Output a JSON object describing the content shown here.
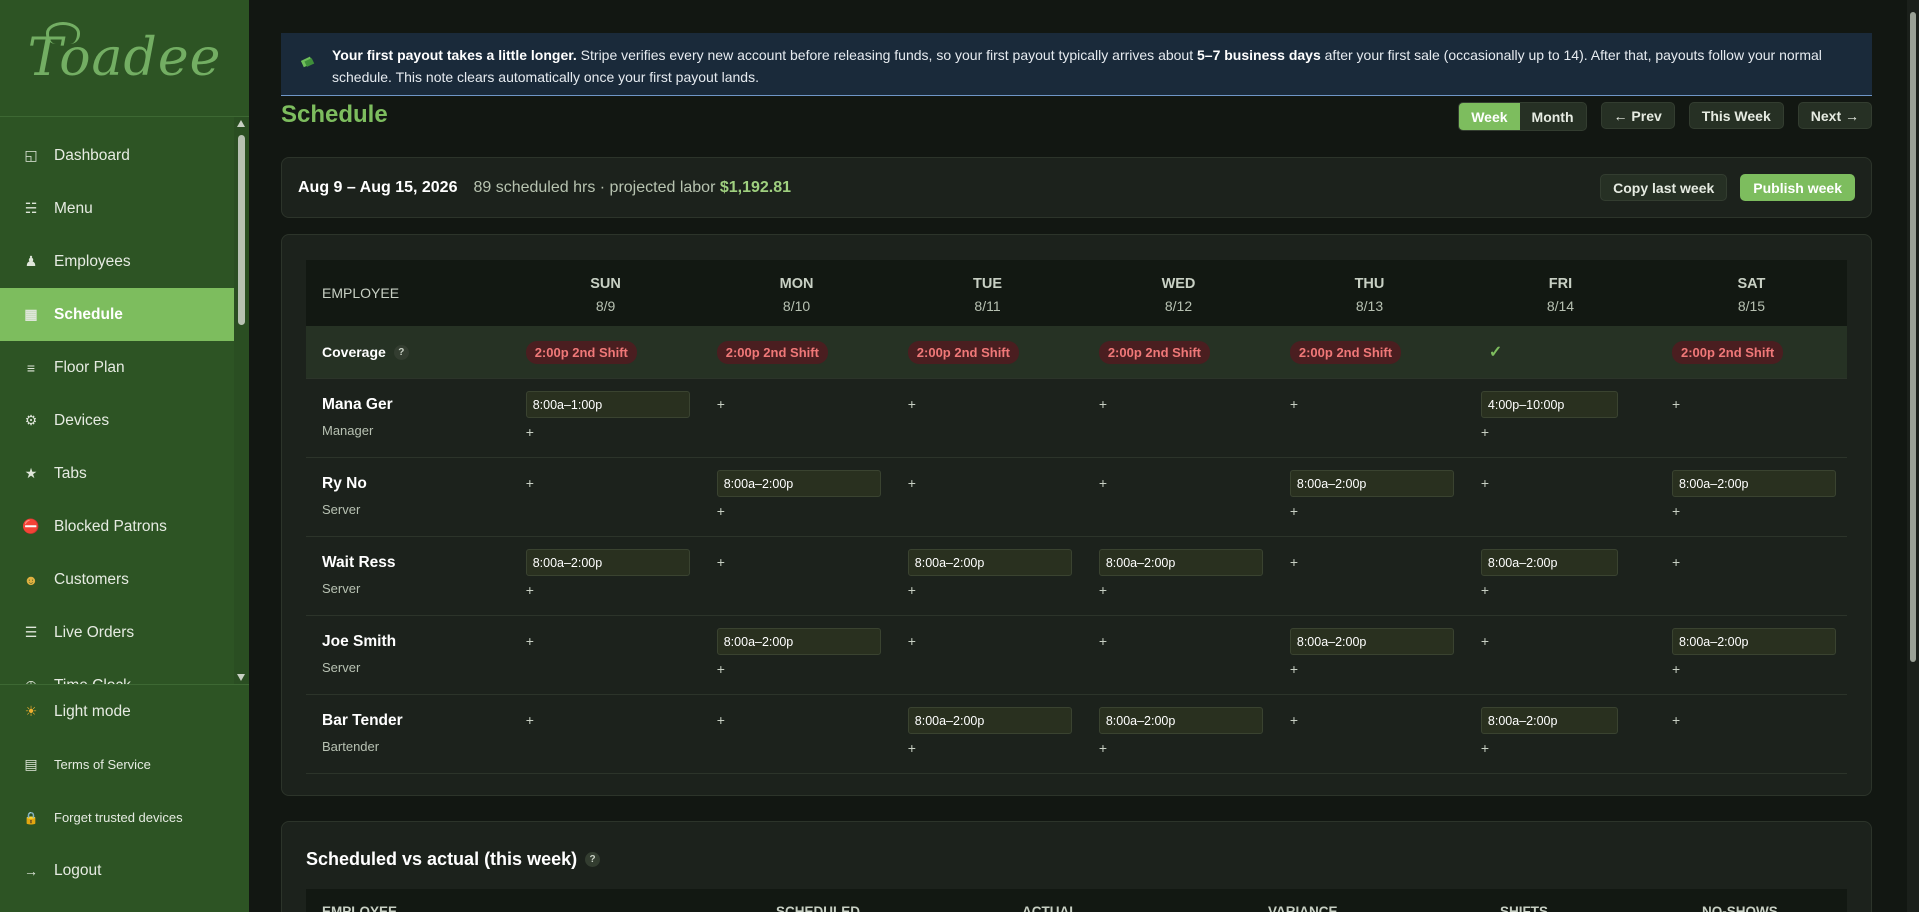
{
  "brand": {
    "logo_text": "Toadee"
  },
  "sidebar": {
    "items": [
      {
        "label": "Dashboard",
        "icon": "dashboard-icon"
      },
      {
        "label": "Menu",
        "icon": "menu-list-icon"
      },
      {
        "label": "Employees",
        "icon": "person-icon"
      },
      {
        "label": "Schedule",
        "icon": "calendar-icon",
        "active": true
      },
      {
        "label": "Floor Plan",
        "icon": "floor-plan-icon"
      },
      {
        "label": "Devices",
        "icon": "gear-icon"
      },
      {
        "label": "Tabs",
        "icon": "star-icon"
      },
      {
        "label": "Blocked Patrons",
        "icon": "no-entry-icon"
      },
      {
        "label": "Customers",
        "icon": "customer-face-icon"
      },
      {
        "label": "Live Orders",
        "icon": "list-icon"
      },
      {
        "label": "Time Clock",
        "icon": "clock-icon"
      }
    ],
    "bottom": [
      {
        "label": "Light mode",
        "icon": "sun-icon"
      },
      {
        "label": "Terms of Service",
        "icon": "document-icon"
      },
      {
        "label": "Forget trusted devices",
        "icon": "lock-icon"
      },
      {
        "label": "Logout",
        "icon": "logout-arrow-icon"
      }
    ]
  },
  "banner": {
    "bold_lead": "Your first payout takes a little longer.",
    "text_1": " Stripe verifies every new account before releasing funds, so your first payout typically arrives about ",
    "bold_mid": "5–7 business days",
    "text_2": " after your first sale (occasionally up to 14). After that, payouts follow your normal schedule. This note clears automatically once your first payout lands."
  },
  "page": {
    "title": "Schedule"
  },
  "view_toggle": {
    "week": "Week",
    "month": "Month",
    "active": "Week"
  },
  "nav_buttons": {
    "prev": "← Prev",
    "this_week": "This Week",
    "next": "Next →"
  },
  "week": {
    "range": "Aug 9 – Aug 15, 2026",
    "meta_prefix": "89 scheduled hrs · projected labor ",
    "labor": "$1,192.81",
    "copy_label": "Copy last week",
    "publish_label": "Publish week"
  },
  "grid": {
    "employee_header": "EMPLOYEE",
    "days": [
      {
        "name": "SUN",
        "date": "8/9"
      },
      {
        "name": "MON",
        "date": "8/10"
      },
      {
        "name": "TUE",
        "date": "8/11"
      },
      {
        "name": "WED",
        "date": "8/12"
      },
      {
        "name": "THU",
        "date": "8/13"
      },
      {
        "name": "FRI",
        "date": "8/14"
      },
      {
        "name": "SAT",
        "date": "8/15"
      }
    ],
    "coverage_label": "Coverage",
    "help": "?",
    "coverage": [
      "2:00p 2nd Shift",
      "2:00p 2nd Shift",
      "2:00p 2nd Shift",
      "2:00p 2nd Shift",
      "2:00p 2nd Shift",
      "✓",
      "2:00p 2nd Shift"
    ],
    "add": "+",
    "employees": [
      {
        "name": "Mana Ger",
        "role": "Manager",
        "shifts": [
          "8:00a–1:00p",
          "",
          "",
          "",
          "",
          "4:00p–10:00p",
          ""
        ]
      },
      {
        "name": "Ry No",
        "role": "Server",
        "shifts": [
          "",
          "8:00a–2:00p",
          "",
          "",
          "8:00a–2:00p",
          "",
          "8:00a–2:00p"
        ]
      },
      {
        "name": "Wait Ress",
        "role": "Server",
        "shifts": [
          "8:00a–2:00p",
          "",
          "8:00a–2:00p",
          "8:00a–2:00p",
          "",
          "8:00a–2:00p",
          ""
        ]
      },
      {
        "name": "Joe Smith",
        "role": "Server",
        "shifts": [
          "",
          "8:00a–2:00p",
          "",
          "",
          "8:00a–2:00p",
          "",
          "8:00a–2:00p"
        ]
      },
      {
        "name": "Bar Tender",
        "role": "Bartender",
        "shifts": [
          "",
          "",
          "8:00a–2:00p",
          "8:00a–2:00p",
          "",
          "8:00a–2:00p",
          ""
        ]
      }
    ]
  },
  "actuals": {
    "title": "Scheduled vs actual (this week)",
    "headers": [
      "EMPLOYEE",
      "SCHEDULED",
      "ACTUAL",
      "VARIANCE",
      "SHIFTS",
      "NO-SHOWS"
    ]
  }
}
